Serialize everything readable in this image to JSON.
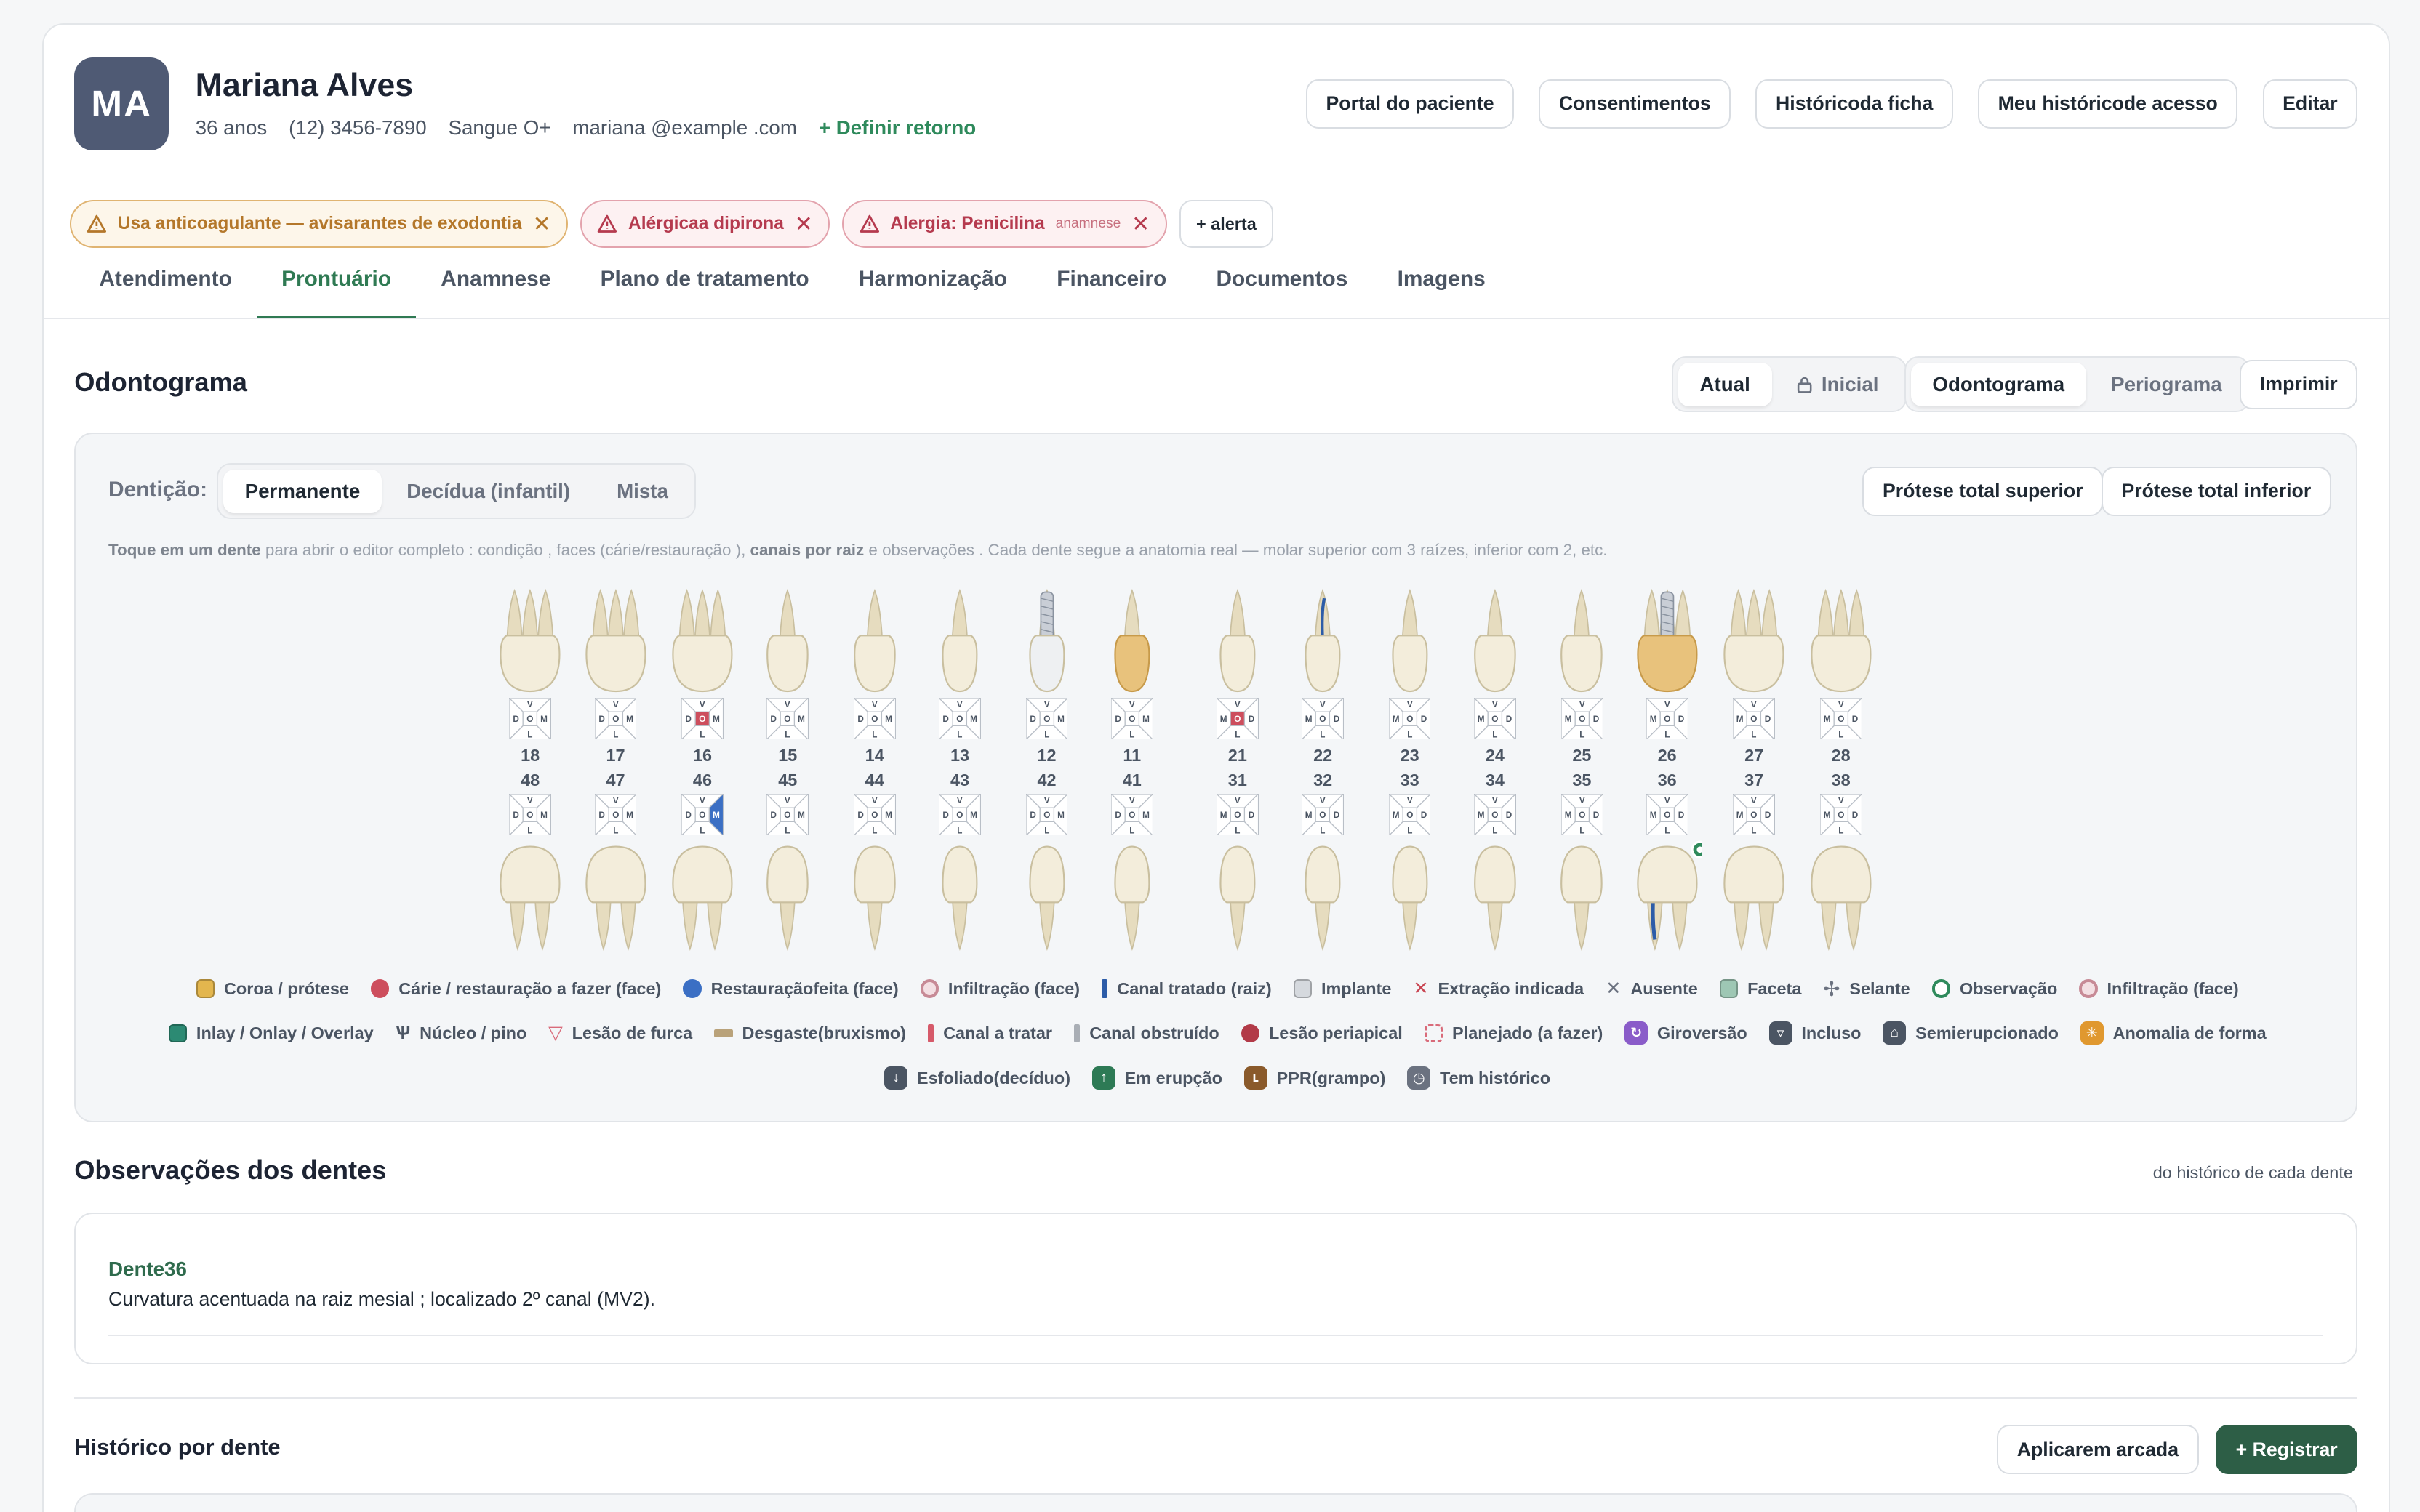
{
  "patient": {
    "initials": "MA",
    "name": "Mariana Alves",
    "age": "36 anos",
    "phone": "(12) 3456-7890",
    "blood": "Sangue O+",
    "email": "mariana @example .com",
    "return_link": "+ Definir retorno"
  },
  "header_buttons": [
    "Portal do paciente",
    "Consentimentos",
    "Históricoda ficha",
    "Meu históricode acesso",
    "Editar"
  ],
  "alerts": [
    {
      "text": "Usa anticoagulante — avisarantes de exodontia",
      "sub": "",
      "kind": "warn"
    },
    {
      "text": "Alérgicaa dipirona",
      "sub": "",
      "kind": "red"
    },
    {
      "text": "Alergia: Penicilina",
      "sub": "anamnese",
      "kind": "red"
    }
  ],
  "add_alert": "+ alerta",
  "tabs": [
    "Atendimento",
    "Prontuário",
    "Anamnese",
    "Plano de tratamento",
    "Harmonização",
    "Financeiro",
    "Documentos",
    "Imagens"
  ],
  "active_tab": "Prontuário",
  "odontograma": {
    "title": "Odontograma",
    "state_options": [
      "Atual",
      "Inicial"
    ],
    "state_selected": "Atual",
    "view_options": [
      "Odontograma",
      "Periograma"
    ],
    "view_selected": "Odontograma",
    "print": "Imprimir",
    "dentition_label": "Dentição:",
    "dentition_options": [
      "Permanente",
      "Decídua (infantil)",
      "Mista"
    ],
    "dentition_selected": "Permanente",
    "prosthesis_buttons": [
      "Prótese total superior",
      "Prótese total inferior"
    ],
    "hint_bold1": "Toque em um dente",
    "hint_1": " para abrir o editor completo : condição , faces (cárie/restauração ), ",
    "hint_bold2": "canais por raiz",
    "hint_2": " e observações . Cada dente segue a anatomia real — molar superior com 3 raízes, inferior com 2, etc.",
    "upper_teeth": [
      "18",
      "17",
      "16",
      "15",
      "14",
      "13",
      "12",
      "11",
      "21",
      "22",
      "23",
      "24",
      "25",
      "26",
      "27",
      "28"
    ],
    "lower_teeth": [
      "48",
      "47",
      "46",
      "45",
      "44",
      "43",
      "42",
      "41",
      "31",
      "32",
      "33",
      "34",
      "35",
      "36",
      "37",
      "38"
    ],
    "face_letters": {
      "top": "V",
      "bottom": "L",
      "left_q1": "D",
      "right_q1": "M",
      "center": "O"
    },
    "tooth_states": {
      "11": "coroa",
      "12": "implante",
      "16": "carie_oclusal",
      "21": "carie_oclusal",
      "22": "canal_tratado",
      "26": "coroa_implante",
      "46": "restauracao_mesial",
      "36": "canal_tratado_observacao"
    },
    "legend": [
      [
        {
          "label": "Coroa / prótese",
          "shape": "sw",
          "color": "#e3b64e"
        },
        {
          "label": "Cárie / restauração a fazer (face)",
          "shape": "dot",
          "color": "#cd4e5d"
        },
        {
          "label": "Restauraçãofeita (face)",
          "shape": "dot",
          "color": "#3b6fc4"
        },
        {
          "label": "Infiltração (face)",
          "shape": "ring",
          "color": "#c78a96"
        },
        {
          "label": "Canal tratado (raiz)",
          "shape": "bar",
          "color": "#2c5ca8"
        },
        {
          "label": "Implante",
          "shape": "sw",
          "color": "#d5d9de"
        },
        {
          "label": "Extração indicada",
          "shape": "x",
          "color": "#c94552"
        },
        {
          "label": "Ausente",
          "shape": "x",
          "color": "#6b7280"
        },
        {
          "label": "Faceta",
          "shape": "sw",
          "color": "#9ec7b4"
        },
        {
          "label": "Selante",
          "shape": "star",
          "color": "#6b7280"
        },
        {
          "label": "Observação",
          "shape": "obs",
          "color": "#2f8a5c"
        },
        {
          "label": "Infiltração (face)",
          "shape": "ring",
          "color": "#c78a96"
        }
      ],
      [
        {
          "label": "Inlay / Onlay / Overlay",
          "shape": "sw",
          "color": "#2c8a73"
        },
        {
          "label": "Núcleo / pino",
          "shape": "pin",
          "color": "#4b5563"
        },
        {
          "label": "Lesão de furca",
          "shape": "tri",
          "color": "#d96b7a"
        },
        {
          "label": "Desgaste(bruxismo)",
          "shape": "flat",
          "color": "#b9a27a"
        },
        {
          "label": "Canal a tratar",
          "shape": "bar",
          "color": "#d65a6a"
        },
        {
          "label": "Canal obstruído",
          "shape": "bar",
          "color": "#a9aeb5"
        },
        {
          "label": "Lesão periapical",
          "shape": "dot",
          "color": "#b23a48"
        },
        {
          "label": "Planejado (a fazer)",
          "shape": "dashed",
          "color": "#d96b7a"
        },
        {
          "label": "Giroversão",
          "shape": "ico",
          "color": "#8a5cc9",
          "glyph": "↻"
        },
        {
          "label": "Incluso",
          "shape": "ico",
          "color": "#4b5563",
          "glyph": "▿"
        },
        {
          "label": "Semierupcionado",
          "shape": "ico",
          "color": "#4b5563",
          "glyph": "⌂"
        },
        {
          "label": "Anomalia de forma",
          "shape": "ico",
          "color": "#e0982f",
          "glyph": "✳"
        }
      ],
      [
        {
          "label": "Esfoliado(decíduo)",
          "shape": "ico",
          "color": "#4b5563",
          "glyph": "↓"
        },
        {
          "label": "Em erupção",
          "shape": "ico",
          "color": "#2d7a55",
          "glyph": "↑"
        },
        {
          "label": "PPR(grampo)",
          "shape": "ico",
          "color": "#8a5a2b",
          "glyph": "ʟ"
        },
        {
          "label": "Tem histórico",
          "shape": "ico",
          "color": "#6b7280",
          "glyph": "◷"
        }
      ]
    ]
  },
  "observacoes": {
    "title": "Observações dos dentes",
    "note": "do histórico de cada dente",
    "items": [
      {
        "title": "Dente36",
        "text": "Curvatura acentuada na raiz mesial ; localizado 2º canal (MV2)."
      }
    ]
  },
  "historico": {
    "title": "Histórico por dente",
    "apply_button": "Aplicarem arcada",
    "register_button": "+ Registrar"
  }
}
